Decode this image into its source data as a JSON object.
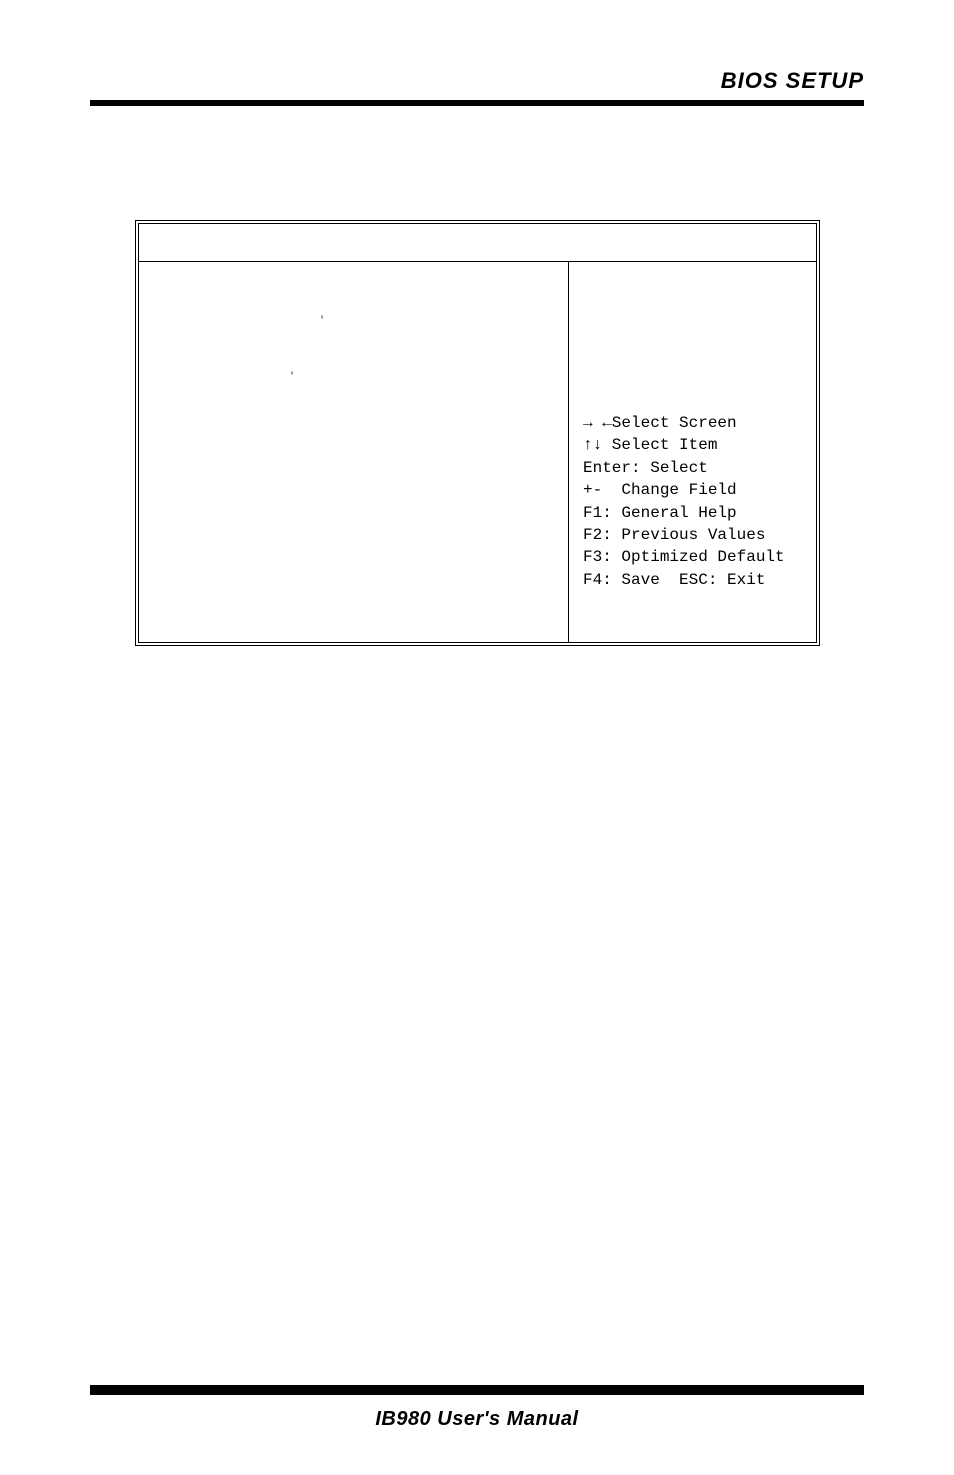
{
  "header": {
    "title": "BIOS SETUP"
  },
  "bios": {
    "help": {
      "select_screen": "→ ←Select Screen",
      "select_item": "↑↓ Select Item",
      "enter": "Enter: Select",
      "change": "+-  Change Field",
      "f1": "F1: General Help",
      "f2": "F2: Previous Values",
      "f3": "F3: Optimized Default",
      "f4": "F4: Save  ESC: Exit"
    }
  },
  "footer": {
    "text": "IB980 User's Manual"
  }
}
